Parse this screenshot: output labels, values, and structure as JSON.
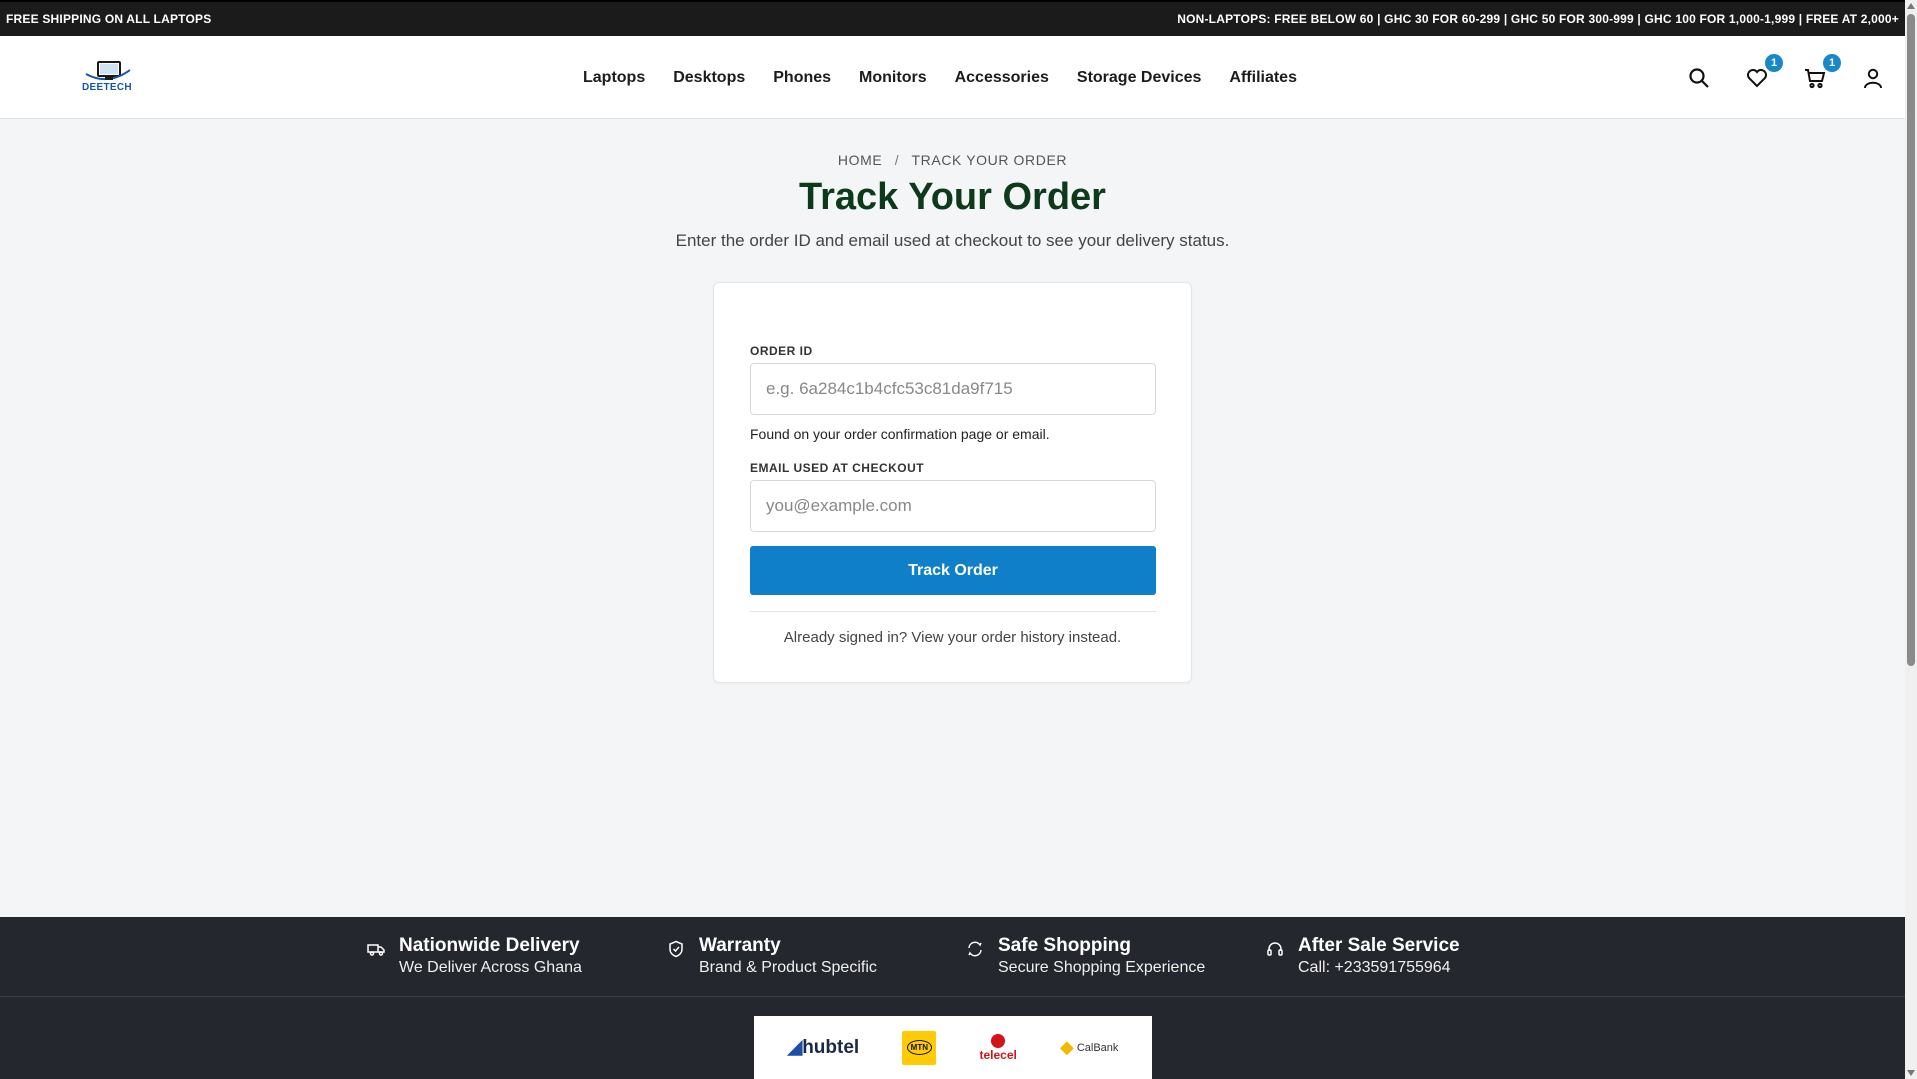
{
  "promo": {
    "left_text": "FREE SHIPPING ON ALL LAPTOPS",
    "right_text": "NON-LAPTOPS: FREE BELOW 60 | GHC 30 FOR 60-299 | GHC 50 FOR 300-999 | GHC 100 FOR 1,000-1,999 | FREE AT 2,000+"
  },
  "header": {
    "logo_text": "DEETECH",
    "nav": [
      "Laptops",
      "Desktops",
      "Phones",
      "Monitors",
      "Accessories",
      "Storage Devices",
      "Affiliates"
    ],
    "icons": {
      "search": "search-icon",
      "wishlist": "heart-icon",
      "cart": "cart-icon",
      "account": "user-icon"
    },
    "wishlist_count": "1",
    "cart_count": "1"
  },
  "breadcrumb": {
    "home": "HOME",
    "separator": "/",
    "current": "TRACK YOUR ORDER"
  },
  "page": {
    "title": "Track Your Order",
    "subtitle": "Enter the order ID and email used at checkout to see your delivery status."
  },
  "form": {
    "order_id_label": "ORDER ID",
    "order_id_placeholder": "e.g. 6a284c1b4cfc53c81da9f715",
    "order_id_value": "",
    "order_id_hint": "Found on your order confirmation page or email.",
    "email_label": "EMAIL USED AT CHECKOUT",
    "email_placeholder": "you@example.com",
    "email_value": "",
    "submit_label": "Track Order",
    "alt_text": "Already signed in? View your order history instead."
  },
  "features": [
    {
      "icon": "truck-icon",
      "title": "Nationwide Delivery",
      "subtitle": "We Deliver Across Ghana"
    },
    {
      "icon": "shield-icon",
      "title": "Warranty",
      "subtitle": "Brand & Product Specific"
    },
    {
      "icon": "refresh-icon",
      "title": "Safe Shopping",
      "subtitle": "Secure Shopping Experience"
    },
    {
      "icon": "headset-icon",
      "title": "After Sale Service",
      "subtitle": "Call: +233591755964"
    }
  ],
  "payments": [
    "hubtel",
    "MTN",
    "telecel",
    "CalBank"
  ],
  "colors": {
    "accent": "#0f7fc9",
    "badge": "#1888c9",
    "title": "#0e3a1c",
    "dark": "#24272d"
  }
}
